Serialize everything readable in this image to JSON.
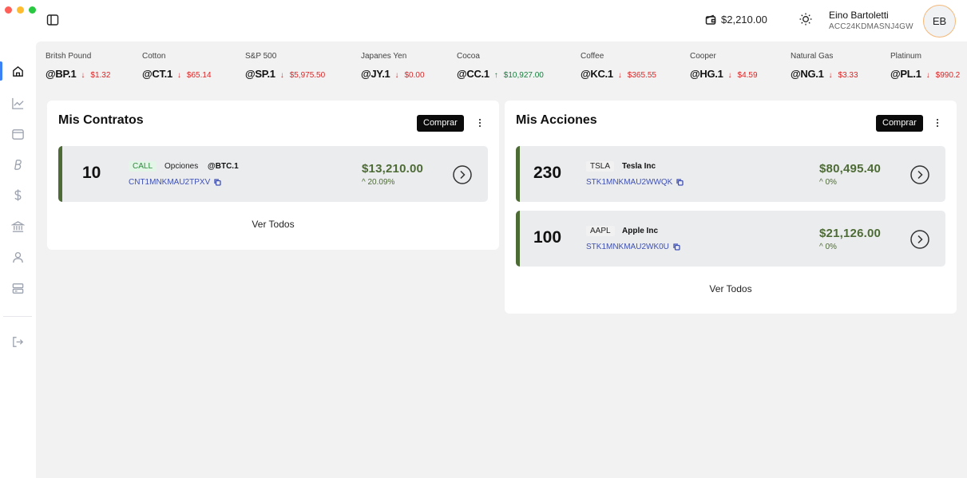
{
  "window": {
    "traffic_lights": [
      "#ff5f57",
      "#febc2e",
      "#28c840"
    ]
  },
  "header": {
    "balance": "$2,210.00",
    "user_name": "Eino Bartoletti",
    "account_id": "ACC24KDMASNJ4GW",
    "avatar_initials": "EB"
  },
  "sidebar": {
    "items": [
      {
        "icon": "home-icon",
        "active": true
      },
      {
        "icon": "chart-line-icon"
      },
      {
        "icon": "folder-icon"
      },
      {
        "icon": "bitcoin-icon"
      },
      {
        "icon": "dollar-icon"
      },
      {
        "icon": "bank-icon"
      },
      {
        "icon": "user-icon"
      },
      {
        "icon": "database-icon"
      },
      {
        "icon": "logout-icon"
      }
    ]
  },
  "ticker": [
    {
      "name": "Britsh Pound",
      "symbol": "@BP.1",
      "direction": "down",
      "price": "$1.32"
    },
    {
      "name": "Cotton",
      "symbol": "@CT.1",
      "direction": "down",
      "price": "$65.14"
    },
    {
      "name": "S&P 500",
      "symbol": "@SP.1",
      "direction": "down",
      "price": "$5,975.50"
    },
    {
      "name": "Japanes Yen",
      "symbol": "@JY.1",
      "direction": "down",
      "price": "$0.00"
    },
    {
      "name": "Cocoa",
      "symbol": "@CC.1",
      "direction": "up",
      "price": "$10,927.00"
    },
    {
      "name": "Coffee",
      "symbol": "@KC.1",
      "direction": "down",
      "price": "$365.55"
    },
    {
      "name": "Cooper",
      "symbol": "@HG.1",
      "direction": "down",
      "price": "$4.59"
    },
    {
      "name": "Natural Gas",
      "symbol": "@NG.1",
      "direction": "down",
      "price": "$3.33"
    },
    {
      "name": "Platinum",
      "symbol": "@PL.1",
      "direction": "down",
      "price": "$990.2"
    }
  ],
  "contracts": {
    "title": "Mis Contratos",
    "buy_label": "Comprar",
    "see_all": "Ver Todos",
    "items": [
      {
        "qty": "10",
        "type": "CALL",
        "kind": "Opciones",
        "symbol": "@BTC.1",
        "code": "CNT1MNKMAU2TPXV",
        "amount": "$13,210.00",
        "change": "20.09%"
      }
    ]
  },
  "stocks": {
    "title": "Mis Acciones",
    "buy_label": "Comprar",
    "see_all": "Ver Todos",
    "items": [
      {
        "qty": "230",
        "ticker": "TSLA",
        "company": "Tesla Inc",
        "code": "STK1MNKMAU2WWQK",
        "amount": "$80,495.40",
        "change": "0%"
      },
      {
        "qty": "100",
        "ticker": "AAPL",
        "company": "Apple Inc",
        "code": "STK1MNKMAU2WK0U",
        "amount": "$21,126.00",
        "change": "0%"
      }
    ]
  },
  "colors": {
    "accent_green": "#4d6b35",
    "down_red": "#dc2626",
    "up_green": "#15803d",
    "code_blue": "#3f51b5"
  }
}
